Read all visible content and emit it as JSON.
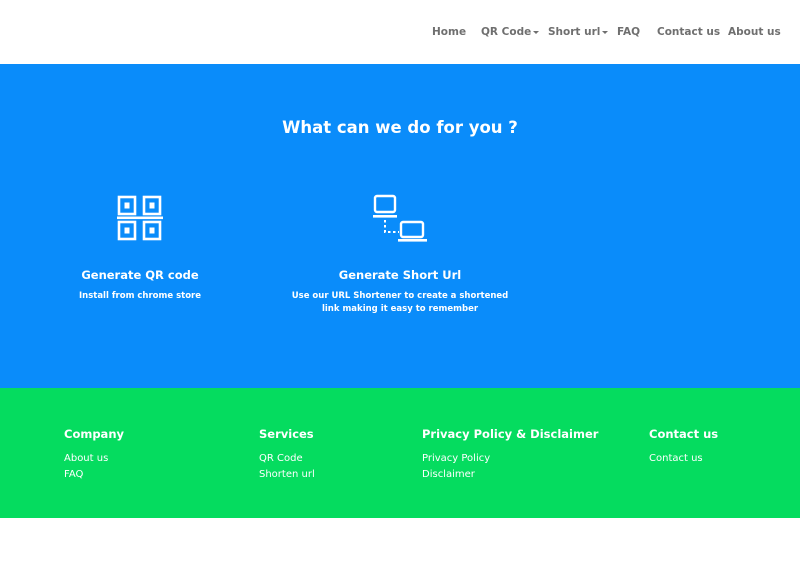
{
  "nav": {
    "home": "Home",
    "qr_code": "QR Code",
    "short_url": "Short url",
    "faq": "FAQ",
    "contact_us": "Contact us",
    "about_us": "About us"
  },
  "hero": {
    "title": "What can we do for you ?",
    "services": [
      {
        "icon": "qr-code-icon",
        "title": "Generate QR code",
        "description_lines": [
          "Install from chrome store"
        ]
      },
      {
        "icon": "link-devices-icon",
        "title": "Generate Short Url",
        "description_lines": [
          "Use our URL Shortener to create a shortened",
          "link making it easy to remember"
        ]
      }
    ]
  },
  "footer": {
    "columns": [
      {
        "heading": "Company",
        "links": [
          "About us",
          "FAQ"
        ]
      },
      {
        "heading": "Services",
        "links": [
          "QR Code",
          "Shorten url"
        ]
      },
      {
        "heading": "Privacy Policy & Disclaimer",
        "links": [
          "Privacy Policy",
          "Disclaimer"
        ]
      },
      {
        "heading": "Contact us",
        "links": [
          "Contact us"
        ]
      }
    ]
  },
  "colors": {
    "hero_bg": "#0a8cfa",
    "footer_bg": "#05dc5f",
    "nav_text": "#6f6f6f"
  }
}
